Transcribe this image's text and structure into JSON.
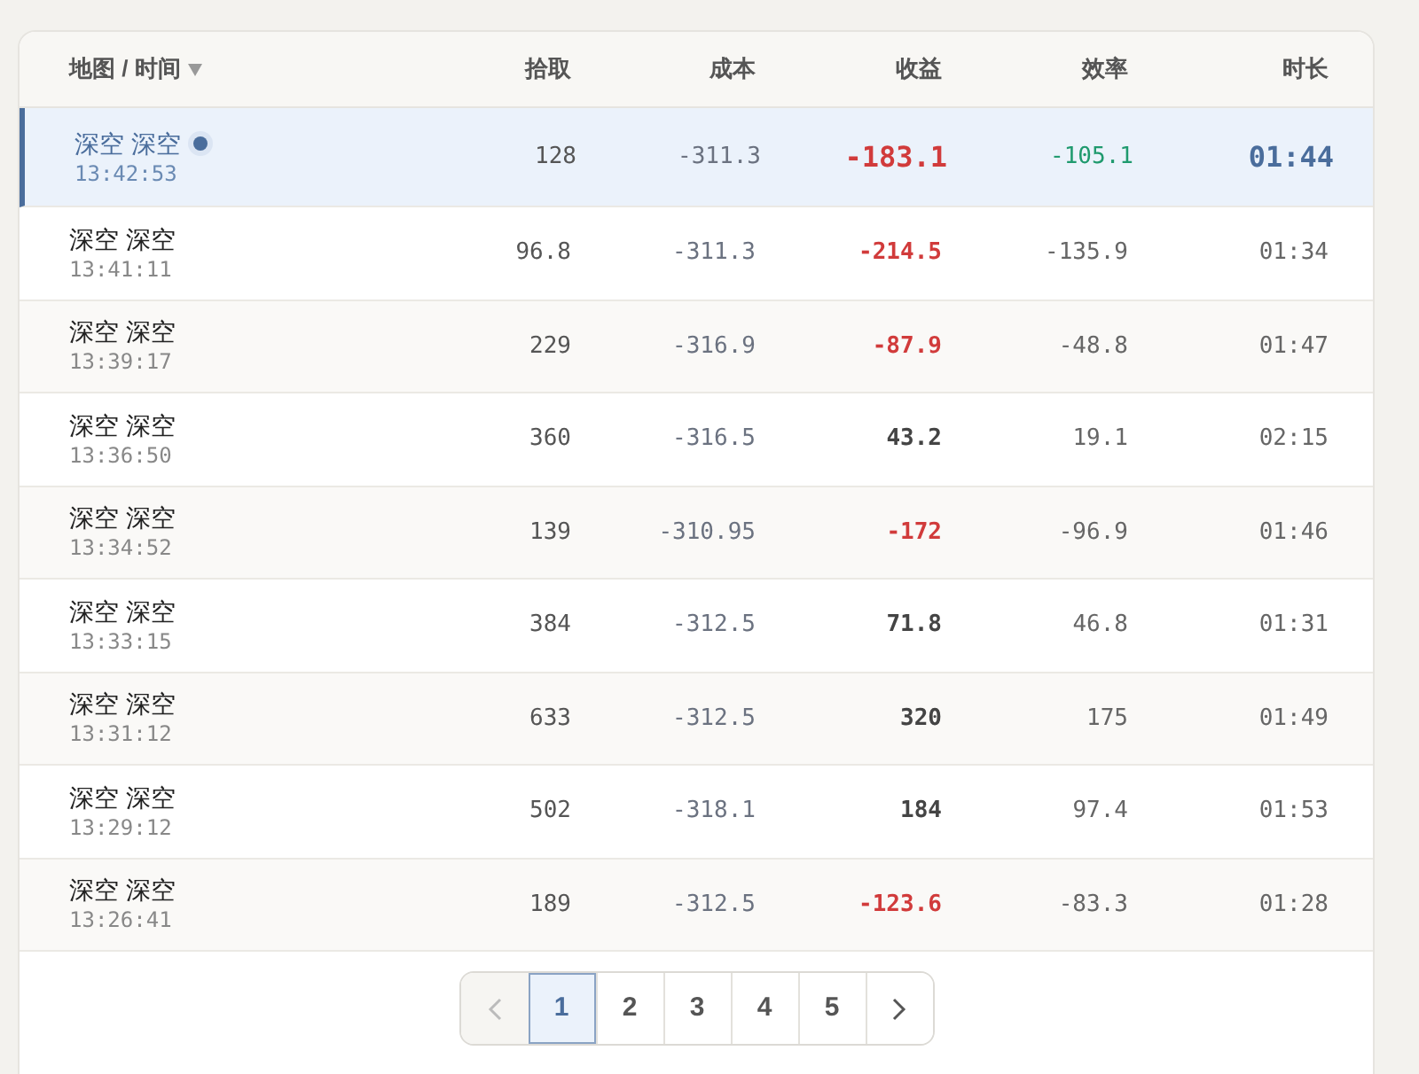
{
  "table": {
    "columns": [
      {
        "label": "地图 / 时间",
        "sortable": true
      },
      {
        "label": "拾取",
        "sortable": false
      },
      {
        "label": "成本",
        "sortable": false
      },
      {
        "label": "收益",
        "sortable": false
      },
      {
        "label": "效率",
        "sortable": false
      },
      {
        "label": "时长",
        "sortable": false
      }
    ],
    "rows": [
      {
        "map": "深空 深空",
        "time": "13:42:53",
        "pickup": "128",
        "cost": "-311.3",
        "profit": "-183.1",
        "profit_negative": true,
        "efficiency": "-105.1",
        "duration": "01:44",
        "selected": true
      },
      {
        "map": "深空 深空",
        "time": "13:41:11",
        "pickup": "96.8",
        "cost": "-311.3",
        "profit": "-214.5",
        "profit_negative": true,
        "efficiency": "-135.9",
        "duration": "01:34",
        "selected": false
      },
      {
        "map": "深空 深空",
        "time": "13:39:17",
        "pickup": "229",
        "cost": "-316.9",
        "profit": "-87.9",
        "profit_negative": true,
        "efficiency": "-48.8",
        "duration": "01:47",
        "selected": false
      },
      {
        "map": "深空 深空",
        "time": "13:36:50",
        "pickup": "360",
        "cost": "-316.5",
        "profit": "43.2",
        "profit_negative": false,
        "efficiency": "19.1",
        "duration": "02:15",
        "selected": false
      },
      {
        "map": "深空 深空",
        "time": "13:34:52",
        "pickup": "139",
        "cost": "-310.95",
        "profit": "-172",
        "profit_negative": true,
        "efficiency": "-96.9",
        "duration": "01:46",
        "selected": false
      },
      {
        "map": "深空 深空",
        "time": "13:33:15",
        "pickup": "384",
        "cost": "-312.5",
        "profit": "71.8",
        "profit_negative": false,
        "efficiency": "46.8",
        "duration": "01:31",
        "selected": false
      },
      {
        "map": "深空 深空",
        "time": "13:31:12",
        "pickup": "633",
        "cost": "-312.5",
        "profit": "320",
        "profit_negative": false,
        "efficiency": "175",
        "duration": "01:49",
        "selected": false
      },
      {
        "map": "深空 深空",
        "time": "13:29:12",
        "pickup": "502",
        "cost": "-318.1",
        "profit": "184",
        "profit_negative": false,
        "efficiency": "97.4",
        "duration": "01:53",
        "selected": false
      },
      {
        "map": "深空 深空",
        "time": "13:26:41",
        "pickup": "189",
        "cost": "-312.5",
        "profit": "-123.6",
        "profit_negative": true,
        "efficiency": "-83.3",
        "duration": "01:28",
        "selected": false
      }
    ]
  },
  "pagination": {
    "prev_disabled": true,
    "next_disabled": false,
    "pages": [
      {
        "label": "1",
        "selected": true
      },
      {
        "label": "2",
        "selected": false
      },
      {
        "label": "3",
        "selected": false
      },
      {
        "label": "4",
        "selected": false
      },
      {
        "label": "5",
        "selected": false
      }
    ]
  }
}
